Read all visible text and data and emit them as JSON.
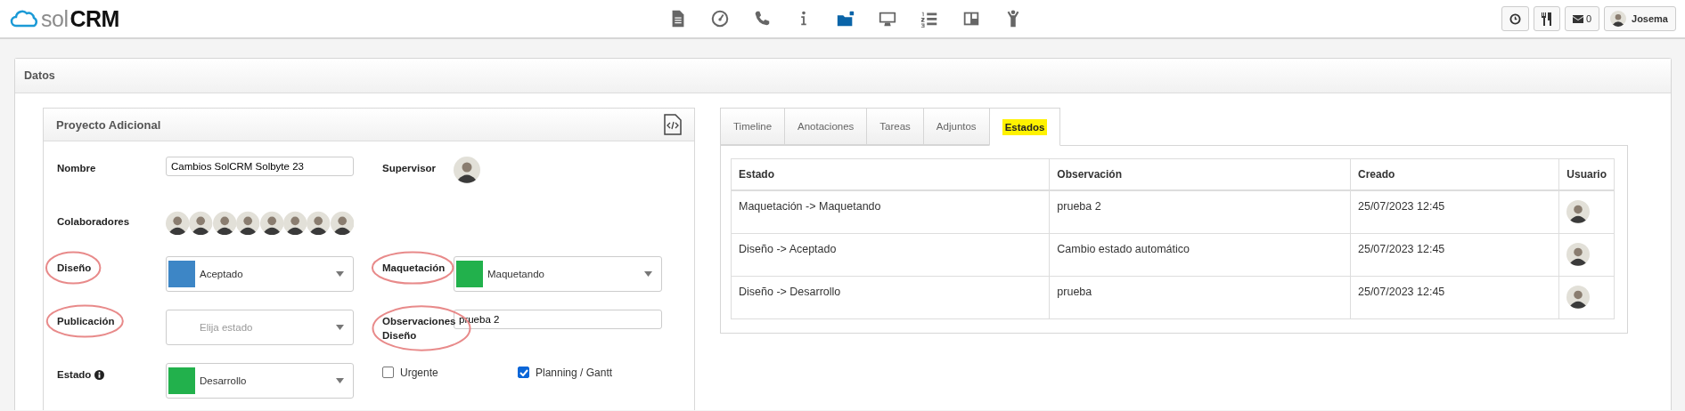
{
  "header": {
    "logo": {
      "light": "sol",
      "bold": "CRM"
    },
    "nav": [
      {
        "kind": "document",
        "selected": false
      },
      {
        "kind": "gauge",
        "selected": false
      },
      {
        "kind": "phone",
        "selected": false
      },
      {
        "kind": "info",
        "selected": false
      },
      {
        "kind": "folder",
        "selected": true
      },
      {
        "kind": "monitor",
        "selected": false
      },
      {
        "kind": "list",
        "selected": false
      },
      {
        "kind": "columns",
        "selected": false
      },
      {
        "kind": "person",
        "selected": false
      }
    ],
    "actions": [
      {
        "kind": "clock"
      },
      {
        "kind": "cutlery"
      },
      {
        "kind": "mail",
        "text": "0"
      },
      {
        "kind": "user",
        "text": "Josema"
      }
    ]
  },
  "panel": {
    "title": "Datos"
  },
  "project": {
    "title": "Proyecto Adicional",
    "fields": [
      {
        "kind": "text",
        "label": "Nombre",
        "value": "Cambios SolCRM Solbyte 23",
        "circled": false
      },
      {
        "kind": "avatars",
        "label": "Supervisor",
        "avatars": [
          {
            "kind": "photo"
          }
        ],
        "circled": false
      },
      {
        "kind": "avatars",
        "label": "Colaboradores",
        "avatars": [
          {
            "kind": "photo"
          },
          {
            "kind": "photo"
          },
          {
            "kind": "photo"
          },
          {
            "kind": "photo"
          },
          {
            "kind": "photo"
          },
          {
            "kind": "photo"
          },
          {
            "kind": "photo"
          },
          {
            "kind": "photo"
          }
        ],
        "circled": false
      },
      {
        "kind": "spacer"
      },
      {
        "kind": "select",
        "label": "Diseño",
        "value": "Aceptado",
        "color": "#3d86c6",
        "circled": true
      },
      {
        "kind": "select",
        "label": "Maquetación",
        "value": "Maquetando",
        "color": "#22b14c",
        "circled": true
      },
      {
        "kind": "select",
        "label": "Publicación",
        "placeholder": "Elija estado",
        "circled": true
      },
      {
        "kind": "text",
        "label": "Observaciones Diseño",
        "value": "prueba 2",
        "circled": true
      },
      {
        "kind": "select",
        "label": "Estado",
        "info": true,
        "value": "Desarrollo",
        "color": "#22b14c",
        "circled": false
      },
      {
        "kind": "checkbox",
        "label": "Urgente",
        "checked": false
      },
      {
        "kind": "checkbox",
        "label": "Planning / Gantt",
        "checked": true
      }
    ]
  },
  "states": {
    "tabs": [
      {
        "label": "Timeline",
        "selected": false,
        "highlighted": false
      },
      {
        "label": "Anotaciones",
        "selected": false,
        "highlighted": false
      },
      {
        "label": "Tareas",
        "selected": false,
        "highlighted": false
      },
      {
        "label": "Adjuntos",
        "selected": false,
        "highlighted": false
      },
      {
        "label": "Estados",
        "selected": true,
        "highlighted": true
      }
    ],
    "table": {
      "columns": [
        "Estado",
        "Observación",
        "Creado",
        "Usuario"
      ],
      "rows": [
        [
          "Maquetación -> Maquetando",
          "prueba 2",
          "25/07/2023 12:45"
        ],
        [
          "Diseño -> Aceptado",
          "Cambio estado automático",
          "25/07/2023 12:45"
        ],
        [
          "Diseño -> Desarrollo",
          "prueba",
          "25/07/2023 12:45"
        ]
      ]
    }
  }
}
